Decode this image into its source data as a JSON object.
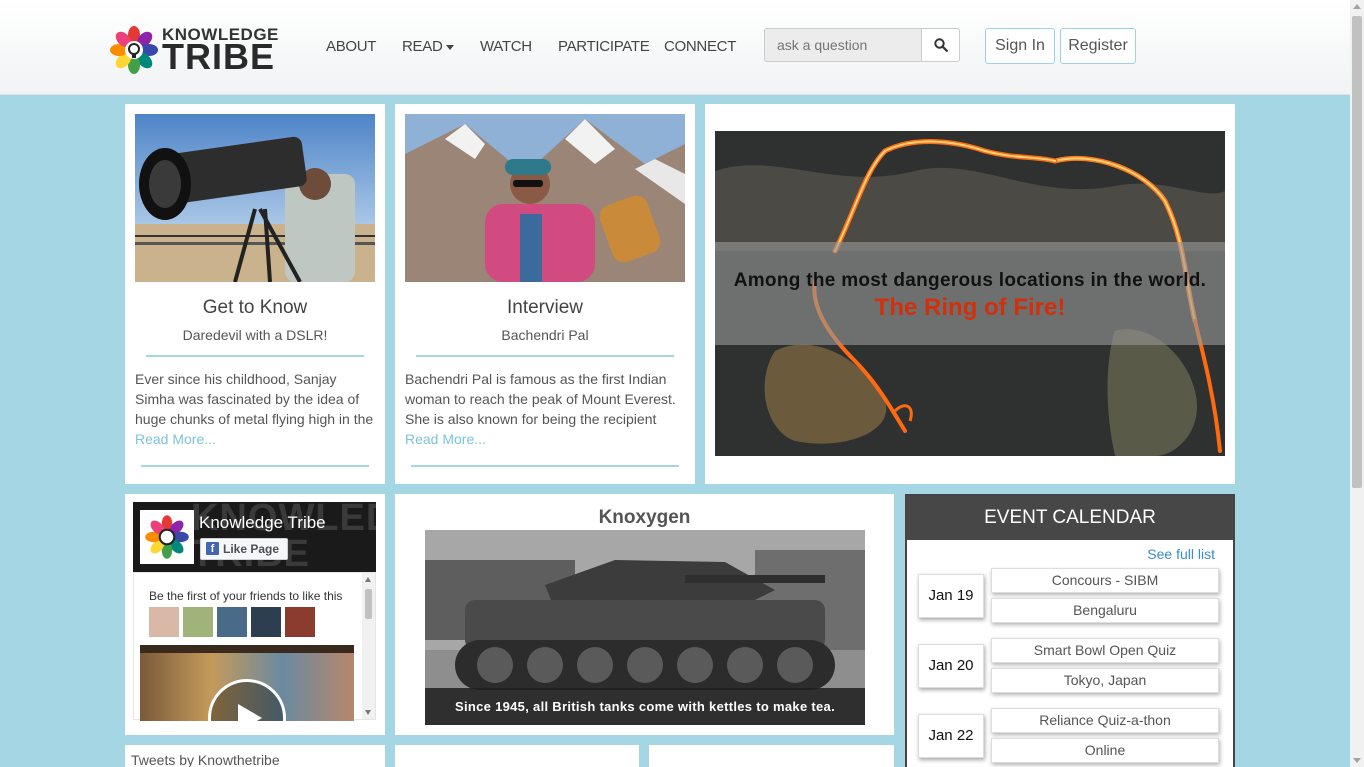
{
  "brand": {
    "line1": "KNOWLEDGE",
    "line2": "TRIBE"
  },
  "nav": {
    "about": "ABOUT",
    "read": "READ",
    "watch": "WATCH",
    "participate": "PARTICIPATE",
    "connect": "CONNECT"
  },
  "search": {
    "placeholder": "ask a question"
  },
  "auth": {
    "sign_in": "Sign In",
    "register": "Register"
  },
  "cards": [
    {
      "title": "Get to Know",
      "subtitle": "Daredevil with a DSLR!",
      "body": "Ever since his childhood, Sanjay Simha was fascinated by the idea of huge chunks of metal flying high in the air.",
      "more": "Read More..."
    },
    {
      "title": "Interview",
      "subtitle": "Bachendri Pal",
      "body": "Bachendri Pal is famous as the first Indian woman to reach the peak of Mount Everest. She is also known for being the recipient",
      "more": "Read More..."
    }
  ],
  "feature": {
    "line1": "Among the most dangerous locations in the world.",
    "line2": "The Ring of Fire!"
  },
  "facebook": {
    "page_name": "Knowledge Tribe",
    "like_label": "Like Page",
    "friends_text": "Be the first of your friends to like this",
    "bg_text": "KNOWLEDGE TRIBE"
  },
  "knoxygen": {
    "title": "Knoxygen",
    "caption": "Since 1945, all British tanks come with kettles to make tea."
  },
  "calendar": {
    "title": "EVENT CALENDAR",
    "see_full": "See full list",
    "events": [
      {
        "date": "Jan 19",
        "name": "Concours - SIBM",
        "location": "Bengaluru"
      },
      {
        "date": "Jan 20",
        "name": "Smart Bowl Open Quiz",
        "location": "Tokyo, Japan"
      },
      {
        "date": "Jan 22",
        "name": "Reliance Quiz-a-thon",
        "location": "Online"
      }
    ]
  },
  "tweets": {
    "title": "Tweets by Knowthetribe"
  },
  "colors": {
    "page_bg": "#a4d6e3",
    "accent": "#7cc4db",
    "ring_red": "#d2300c",
    "calendar_head": "#474747"
  }
}
